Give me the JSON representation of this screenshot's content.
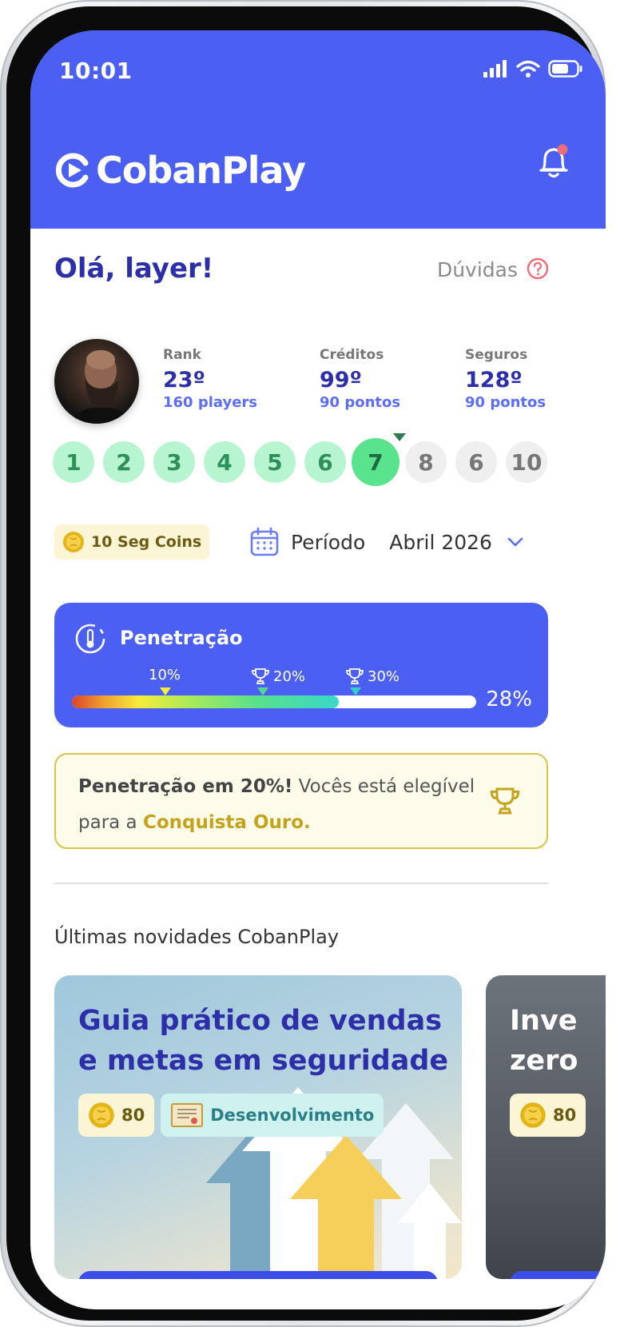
{
  "status_bar": {
    "time": "10:01"
  },
  "header": {
    "app_name": "CobanPlay"
  },
  "greeting": {
    "text": "Olá, layer!",
    "help_label": "Dúvidas"
  },
  "stats": [
    {
      "label": "Rank",
      "value": "23º",
      "sub": "160 players"
    },
    {
      "label": "Créditos",
      "value": "99º",
      "sub": "90 pontos"
    },
    {
      "label": "Seguros",
      "value": "128º",
      "sub": "90 pontos"
    }
  ],
  "levels": {
    "items": [
      "1",
      "2",
      "3",
      "4",
      "5",
      "6",
      "7",
      "8",
      "6",
      "10"
    ],
    "current": "7"
  },
  "coins": {
    "label": "10 Seg Coins"
  },
  "period": {
    "label": "Período",
    "value": "Abril 2026"
  },
  "penetration": {
    "title": "Penetração",
    "marks": [
      "10%",
      "20%",
      "30%"
    ],
    "value_label": "28%",
    "progress": 0.66
  },
  "notice": {
    "bold": "Penetração em 20%!",
    "text": " Vocês está elegível para a ",
    "highlight": "Conquista Ouro."
  },
  "news": {
    "title": "Últimas novidades CobanPlay",
    "cards": [
      {
        "title": "Guia prático de vendas e metas em seguridade",
        "coins": "80",
        "category": "Desenvolvimento"
      },
      {
        "title": "Inve zero",
        "coins": "80"
      }
    ]
  },
  "colors": {
    "primary": "#4b5ff2",
    "title": "#2d2fa8",
    "accent_gold": "#c4a21c",
    "level_done": "#b7f5d0",
    "level_current": "#59e38c"
  },
  "icons": [
    "signal-icon",
    "wifi-icon",
    "battery-icon",
    "play-logo-icon",
    "bell-icon",
    "help-icon",
    "calendar-icon",
    "chevron-down-icon",
    "thermometer-icon",
    "trophy-icon",
    "coin-icon",
    "certificate-icon"
  ]
}
